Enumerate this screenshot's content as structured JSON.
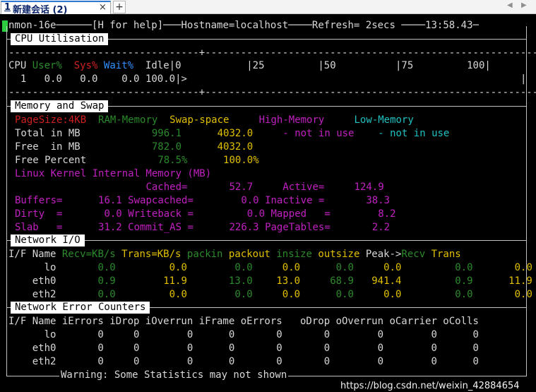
{
  "tab": {
    "number": "1",
    "title": "新建会话 (2)",
    "close": "×",
    "new_tab": "+",
    "nav_left": "◀",
    "nav_right": "▶"
  },
  "header": {
    "app": "nmon-16e",
    "help": "[H for help]",
    "hostname": "Hostname=localhost",
    "refresh": "Refresh= 2secs",
    "time": "13:58.43"
  },
  "cpu": {
    "section_title": "CPU Utilisation",
    "scale_labels": {
      "cpu": "CPU",
      "user": "User%",
      "sys": "Sys%",
      "wait": "Wait%",
      "idle": "Idle",
      "s0": "|0",
      "s25": "|25",
      "s50": "|50",
      "s75": "|75",
      "s100": "100|"
    },
    "row": {
      "cpu": "1",
      "user": "0.0",
      "sys": "0.0",
      "wait": "0.0",
      "idle": "100.0",
      "bar": "|>",
      "end": "|"
    },
    "rule": "--------------------------------+---------------------------------------------------------+"
  },
  "memory": {
    "section_title": "Memory and Swap",
    "headers": {
      "pagesize": "PageSize:4KB",
      "ram": "RAM-Memory",
      "swap": "Swap-space",
      "high": "High-Memory",
      "low": "Low-Memory"
    },
    "total": {
      "label": "Total in MB",
      "ram": "996.1",
      "swap": "4032.0",
      "high": "- not in use",
      "low": "- not in use"
    },
    "free": {
      "label": "Free  in MB",
      "ram": "782.0",
      "swap": "4032.0"
    },
    "free_pct": {
      "label": "Free Percent",
      "ram": "78.5%",
      "swap": "100.0%"
    },
    "kernel_title": "Linux Kernel Internal Memory (MB)",
    "cached": {
      "label": "Cached=",
      "value": "52.7",
      "label2": "Active=",
      "value2": "124.9"
    },
    "buffers": {
      "label": "Buffers=",
      "value": "16.1",
      "label2": "Swapcached=",
      "value2": "0.0",
      "label3": "Inactive =",
      "value3": "38.3"
    },
    "dirty": {
      "label": "Dirty  =",
      "value": "0.0",
      "label2": "Writeback =",
      "value2": "0.0",
      "label3": "Mapped   =",
      "value3": "8.2"
    },
    "slab": {
      "label": "Slab   =",
      "value": "31.2",
      "label2": "Commit_AS =",
      "value2": "226.3",
      "label3": "PageTables=",
      "value3": "2.2"
    }
  },
  "network": {
    "section_title": "Network I/O",
    "headers": {
      "if": "I/F Name",
      "recv": "Recv=KB/s",
      "trans": "Trans=KB/s",
      "packin": "packin",
      "packout": "packout",
      "insize": "insize",
      "outsize": "outsize",
      "peak": "Peak->",
      "peak_recv": "Recv",
      "peak_trans": "Trans"
    },
    "rows": [
      {
        "name": "lo",
        "recv": "0.0",
        "trans": "0.0",
        "packin": "0.0",
        "packout": "0.0",
        "insize": "0.0",
        "outsize": "0.0",
        "peak_recv": "0.0",
        "peak_trans": "0.0"
      },
      {
        "name": "eth0",
        "recv": "0.9",
        "trans": "11.9",
        "packin": "13.0",
        "packout": "13.0",
        "insize": "68.9",
        "outsize": "941.4",
        "peak_recv": "0.9",
        "peak_trans": "11.9"
      },
      {
        "name": "eth2",
        "recv": "0.0",
        "trans": "0.0",
        "packin": "0.0",
        "packout": "0.0",
        "insize": "0.0",
        "outsize": "0.0",
        "peak_recv": "0.0",
        "peak_trans": "0.0"
      }
    ]
  },
  "errors": {
    "section_title": "Network Error Counters",
    "header": "I/F Name iErrors iDrop iOverrun iFrame oErrors   oDrop oOverrun oCarrier oColls",
    "rows": [
      "      lo       0     0        0      0       0       0        0        0      0",
      "    eth0       0     0        0      0       0       0        0        0      0",
      "    eth2       0     0        0      0       0       0        0        0      0"
    ]
  },
  "footer": {
    "warning": "Warning: Some Statistics may not shown"
  },
  "watermark": "https://blog.csdn.net/weixin_42884654"
}
